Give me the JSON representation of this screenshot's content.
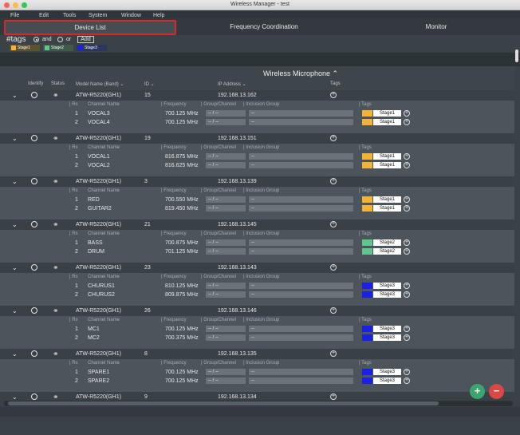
{
  "window": {
    "title": "Wireless Manager - test"
  },
  "menu": [
    "File",
    "Edit",
    "Tools",
    "System",
    "Window",
    "Help"
  ],
  "tabs": [
    "Device List",
    "Frequency Coordination",
    "Monitor"
  ],
  "tags": {
    "title": "#tags",
    "and_label": "and",
    "or_label": "or",
    "add_label": "Add",
    "chips": [
      {
        "label": "Stage1",
        "color": "#f5b236"
      },
      {
        "label": "Stage2",
        "color": "#5fc48d"
      },
      {
        "label": "Stage3",
        "color": "#1b20e6"
      }
    ]
  },
  "table": {
    "section_title": "Wireless Microphone",
    "columns": [
      "Identify",
      "Status",
      "Model Name (Band)",
      "ID",
      "IP Address",
      "Tags"
    ],
    "sub_columns": [
      "Rx",
      "Channel Name",
      "Frequency",
      "Group/Channel",
      "Inclusion Group",
      "Tags"
    ]
  },
  "devices": [
    {
      "model": "ATW-R5220(GH1)",
      "id": "15",
      "ip": "192.168.13.162",
      "channels": [
        {
          "rx": "1",
          "name": "VOCAL3",
          "freq": "700.125 MHz",
          "gc": "--  /  --",
          "ig": "--",
          "tag": "Stage1",
          "tag_color": "#f5b236"
        },
        {
          "rx": "2",
          "name": "VOCAL4",
          "freq": "700.125 MHz",
          "gc": "--  /  --",
          "ig": "--",
          "tag": "Stage1",
          "tag_color": "#f5b236"
        }
      ]
    },
    {
      "model": "ATW-R5220(GH1)",
      "id": "19",
      "ip": "192.168.13.151",
      "channels": [
        {
          "rx": "1",
          "name": "VOCAL1",
          "freq": "816.875 MHz",
          "gc": "--  /  --",
          "ig": "--",
          "tag": "Stage1",
          "tag_color": "#f5b236"
        },
        {
          "rx": "2",
          "name": "VOCAL2",
          "freq": "816.625 MHz",
          "gc": "--  /  --",
          "ig": "--",
          "tag": "Stage1",
          "tag_color": "#f5b236"
        }
      ]
    },
    {
      "model": "ATW-R5220(GH1)",
      "id": "3",
      "ip": "192.168.13.139",
      "channels": [
        {
          "rx": "1",
          "name": "RED",
          "freq": "700.550 MHz",
          "gc": "--  /  --",
          "ig": "--",
          "tag": "Stage1",
          "tag_color": "#f5b236"
        },
        {
          "rx": "2",
          "name": "GUITAR2",
          "freq": "819.450 MHz",
          "gc": "--  /  --",
          "ig": "--",
          "tag": "Stage1",
          "tag_color": "#f5b236"
        }
      ]
    },
    {
      "model": "ATW-R5220(GH1)",
      "id": "21",
      "ip": "192.168.13.145",
      "channels": [
        {
          "rx": "1",
          "name": "BASS",
          "freq": "700.875 MHz",
          "gc": "--  /  --",
          "ig": "--",
          "tag": "Stage2",
          "tag_color": "#5fc48d"
        },
        {
          "rx": "2",
          "name": "DRUM",
          "freq": "701.125 MHz",
          "gc": "--  /  --",
          "ig": "--",
          "tag": "Stage2",
          "tag_color": "#5fc48d"
        }
      ]
    },
    {
      "model": "ATW-R5220(GH1)",
      "id": "23",
      "ip": "192.168.13.143",
      "channels": [
        {
          "rx": "1",
          "name": "CHURUS1",
          "freq": "810.125 MHz",
          "gc": "--  /  --",
          "ig": "--",
          "tag": "Stage3",
          "tag_color": "#1b20e6"
        },
        {
          "rx": "2",
          "name": "CHURUS2",
          "freq": "809.875 MHz",
          "gc": "--  /  --",
          "ig": "--",
          "tag": "Stage3",
          "tag_color": "#1b20e6"
        }
      ]
    },
    {
      "model": "ATW-R5220(GH1)",
      "id": "26",
      "ip": "192.168.13.146",
      "channels": [
        {
          "rx": "1",
          "name": "MC1",
          "freq": "700.125 MHz",
          "gc": "--  /  --",
          "ig": "--",
          "tag": "Stage3",
          "tag_color": "#1b20e6"
        },
        {
          "rx": "2",
          "name": "MC2",
          "freq": "700.375 MHz",
          "gc": "--  /  --",
          "ig": "--",
          "tag": "Stage3",
          "tag_color": "#1b20e6"
        }
      ]
    },
    {
      "model": "ATW-R5220(GH1)",
      "id": "8",
      "ip": "192.168.13.135",
      "channels": [
        {
          "rx": "1",
          "name": "SPARE1",
          "freq": "700.125 MHz",
          "gc": "--  /  --",
          "ig": "--",
          "tag": "Stage3",
          "tag_color": "#1b20e6"
        },
        {
          "rx": "2",
          "name": "SPARE2",
          "freq": "700.125 MHz",
          "gc": "--  /  --",
          "ig": "--",
          "tag": "Stage3",
          "tag_color": "#1b20e6"
        }
      ]
    },
    {
      "model": "ATW-R5220(GH1)",
      "id": "9",
      "ip": "192.168.13.134",
      "channels": []
    }
  ]
}
